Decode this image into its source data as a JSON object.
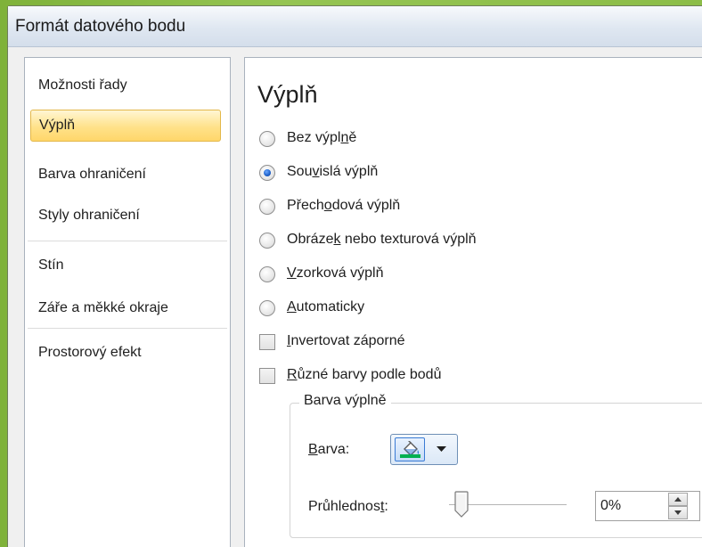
{
  "window": {
    "title": "Formát datového bodu"
  },
  "nav": {
    "items": [
      {
        "label": "Možnosti řady"
      },
      {
        "label": "Výplň",
        "selected": true
      },
      {
        "label": "Barva ohraničení"
      },
      {
        "label": "Styly ohraničení"
      },
      {
        "label": "Stín"
      },
      {
        "label": "Záře a měkké okraje"
      },
      {
        "label": "Prostorový efekt"
      }
    ]
  },
  "fill": {
    "section_title": "Výplň",
    "options": [
      {
        "label_pre": "Bez výpl",
        "label_key": "n",
        "label_post": "ě",
        "checked": false
      },
      {
        "label_pre": "Sou",
        "label_key": "v",
        "label_post": "islá výplň",
        "checked": true
      },
      {
        "label_pre": "Přech",
        "label_key": "o",
        "label_post": "dová výplň",
        "checked": false
      },
      {
        "label_pre": "Obráze",
        "label_key": "k",
        "label_post": " nebo texturová výplň",
        "checked": false
      },
      {
        "label_pre": "",
        "label_key": "V",
        "label_post": "zorková výplň",
        "checked": false
      },
      {
        "label_pre": "",
        "label_key": "A",
        "label_post": "utomaticky",
        "checked": false
      }
    ],
    "checkboxes": [
      {
        "label_pre": "",
        "label_key": "I",
        "label_post": "nvertovat záporné",
        "checked": false
      },
      {
        "label_pre": "",
        "label_key": "R",
        "label_post": "ůzné barvy podle bodů",
        "checked": false
      }
    ],
    "fill_color_group": {
      "legend": "Barva výplně",
      "color_label_key": "B",
      "color_label_post": "arva:",
      "color_value": "#00b050",
      "transparency_label_pre": "Průhlednos",
      "transparency_label_key": "t",
      "transparency_label_post": ":",
      "transparency_value": "0%",
      "transparency_fraction": 0
    }
  },
  "icons": {
    "bucket": "paint-bucket-icon",
    "caret": "caret-down-icon",
    "spin_up": "spin-up-icon",
    "spin_down": "spin-down-icon"
  },
  "colors": {
    "selection": "#ffd66a",
    "accent_green": "#00b050"
  }
}
